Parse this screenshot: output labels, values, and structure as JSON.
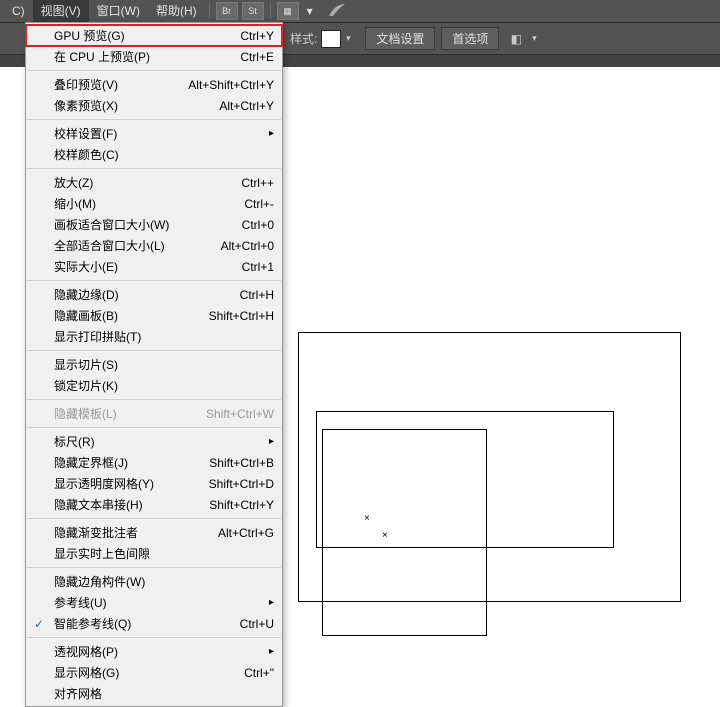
{
  "menubar": {
    "items": [
      "C)",
      "视图(V)",
      "窗口(W)",
      "帮助(H)"
    ],
    "icons": [
      "Br",
      "St"
    ]
  },
  "toolbar": {
    "style_label": "样式:",
    "doc_settings": "文档设置",
    "prefs": "首选项"
  },
  "menu": {
    "items": [
      {
        "label": "GPU 预览(G)",
        "shortcut": "Ctrl+Y",
        "hl": true
      },
      {
        "label": "在 CPU 上预览(P)",
        "shortcut": "Ctrl+E"
      },
      {
        "sep": true
      },
      {
        "label": "叠印预览(V)",
        "shortcut": "Alt+Shift+Ctrl+Y"
      },
      {
        "label": "像素预览(X)",
        "shortcut": "Alt+Ctrl+Y"
      },
      {
        "sep": true
      },
      {
        "label": "校样设置(F)",
        "submenu": true
      },
      {
        "label": "校样颜色(C)"
      },
      {
        "sep": true
      },
      {
        "label": "放大(Z)",
        "shortcut": "Ctrl++"
      },
      {
        "label": "缩小(M)",
        "shortcut": "Ctrl+-"
      },
      {
        "label": "画板适合窗口大小(W)",
        "shortcut": "Ctrl+0"
      },
      {
        "label": "全部适合窗口大小(L)",
        "shortcut": "Alt+Ctrl+0"
      },
      {
        "label": "实际大小(E)",
        "shortcut": "Ctrl+1"
      },
      {
        "sep": true
      },
      {
        "label": "隐藏边缘(D)",
        "shortcut": "Ctrl+H"
      },
      {
        "label": "隐藏画板(B)",
        "shortcut": "Shift+Ctrl+H"
      },
      {
        "label": "显示打印拼贴(T)"
      },
      {
        "sep": true
      },
      {
        "label": "显示切片(S)"
      },
      {
        "label": "锁定切片(K)"
      },
      {
        "sep": true
      },
      {
        "label": "隐藏模板(L)",
        "shortcut": "Shift+Ctrl+W",
        "disabled": true
      },
      {
        "sep": true
      },
      {
        "label": "标尺(R)",
        "submenu": true
      },
      {
        "label": "隐藏定界框(J)",
        "shortcut": "Shift+Ctrl+B"
      },
      {
        "label": "显示透明度网格(Y)",
        "shortcut": "Shift+Ctrl+D"
      },
      {
        "label": "隐藏文本串接(H)",
        "shortcut": "Shift+Ctrl+Y"
      },
      {
        "sep": true
      },
      {
        "label": "隐藏渐变批注者",
        "shortcut": "Alt+Ctrl+G"
      },
      {
        "label": "显示实时上色间隙"
      },
      {
        "sep": true
      },
      {
        "label": "隐藏边角构件(W)"
      },
      {
        "label": "参考线(U)",
        "submenu": true
      },
      {
        "label": "智能参考线(Q)",
        "shortcut": "Ctrl+U",
        "checked": true
      },
      {
        "sep": true
      },
      {
        "label": "透视网格(P)",
        "submenu": true
      },
      {
        "label": "显示网格(G)",
        "shortcut": "Ctrl+\""
      },
      {
        "label": "对齐网格",
        "shortcut": ""
      }
    ]
  }
}
